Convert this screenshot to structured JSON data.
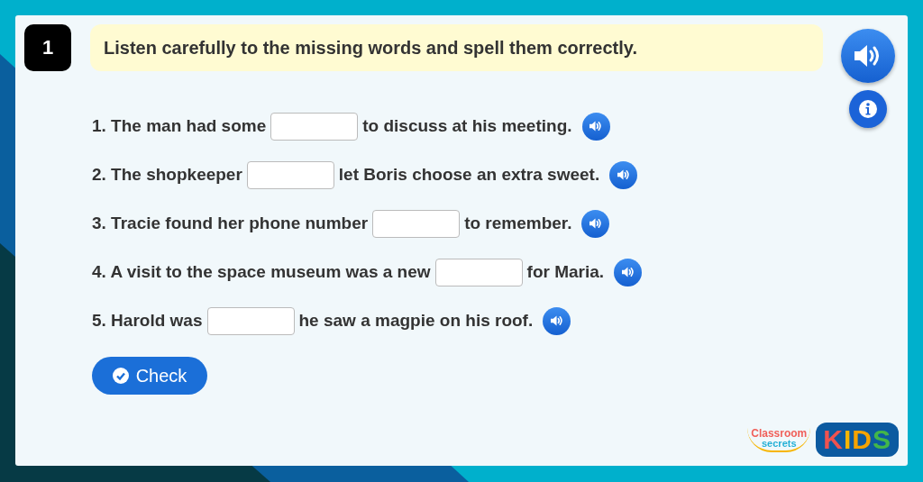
{
  "question": {
    "number": "1",
    "instruction": "Listen carefully to the missing words and spell them correctly."
  },
  "sentences": [
    {
      "before": "1. The man had some",
      "after": "to discuss at his meeting."
    },
    {
      "before": "2. The shopkeeper",
      "after": "let Boris choose an extra sweet."
    },
    {
      "before": "3. Tracie found her phone number",
      "after": "to remember."
    },
    {
      "before": "4. A visit to the space museum was a new",
      "after": "for Maria."
    },
    {
      "before": "5. Harold was",
      "after": "he saw a magpie on his roof."
    }
  ],
  "check_button": {
    "label": "Check"
  },
  "logo": {
    "line_1": "Classroom",
    "line_2": "secrets",
    "badge": "KIDS"
  }
}
